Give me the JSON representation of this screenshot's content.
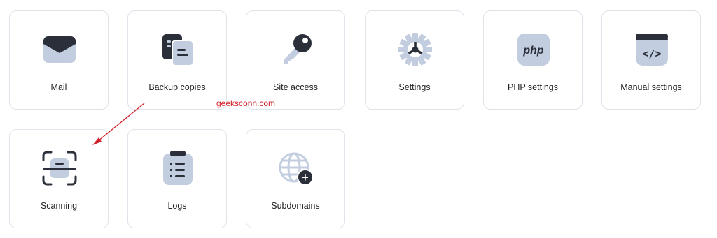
{
  "tiles": [
    {
      "label": "Mail",
      "icon": "mail-icon"
    },
    {
      "label": "Backup copies",
      "icon": "backup-copies-icon"
    },
    {
      "label": "Site access",
      "icon": "key-icon"
    },
    {
      "label": "Settings",
      "icon": "gear-icon"
    },
    {
      "label": "PHP settings",
      "icon": "php-icon",
      "icon_text": "php"
    },
    {
      "label": "Manual settings",
      "icon": "code-brackets-icon",
      "icon_text": "</>"
    },
    {
      "label": "Scanning",
      "icon": "scan-icon"
    },
    {
      "label": "Logs",
      "icon": "clipboard-list-icon"
    },
    {
      "label": "Subdomains",
      "icon": "globe-plus-icon",
      "icon_text": "+"
    }
  ],
  "watermark": "geeksconn.com",
  "colors": {
    "icon_light": "#c3cde0",
    "icon_dark": "#2b2f3a",
    "card_border": "#dfe3ea",
    "annotation": "#d0202a"
  }
}
